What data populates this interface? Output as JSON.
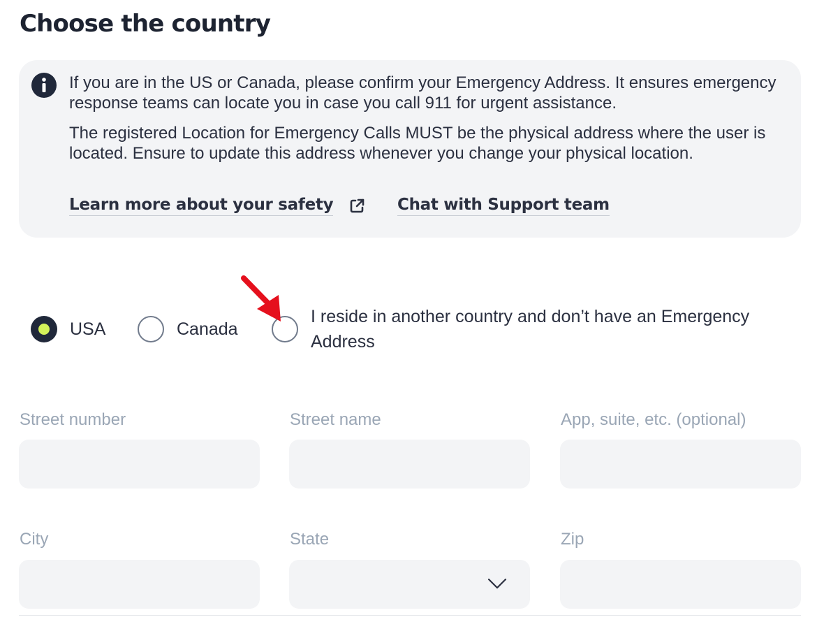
{
  "page": {
    "title": "Choose the country"
  },
  "info": {
    "icon": "info-circle-icon",
    "paragraph_1": "If you are in the US or Canada, please confirm your Emergency Address. It ensures emergency response teams can locate you in case you call 911 for urgent assistance.",
    "paragraph_2": "The registered Location for Emergency Calls MUST be the physical address where the user is located. Ensure to update this address whenever you change your physical location.",
    "link_safety": "Learn more about your safety",
    "link_safety_icon": "external-link-icon",
    "link_support": "Chat with Support team"
  },
  "country": {
    "selected": "USA",
    "options": [
      {
        "label": "USA",
        "checked": true
      },
      {
        "label": "Canada",
        "checked": false
      },
      {
        "label": "I reside in another country and don’t have an Emergency Address",
        "checked": false
      }
    ]
  },
  "annotation": {
    "icon": "red-arrow-icon",
    "color": "#e5101d"
  },
  "form": {
    "street_number": {
      "label": "Street number",
      "value": ""
    },
    "street_name": {
      "label": "Street name",
      "value": ""
    },
    "apartment": {
      "label": "App, suite, etc. (optional)",
      "value": ""
    },
    "city": {
      "label": "City",
      "value": ""
    },
    "state": {
      "label": "State",
      "value": "",
      "icon": "chevron-down-icon"
    },
    "zip": {
      "label": "Zip",
      "value": ""
    }
  },
  "colors": {
    "accent_dark": "#20283a",
    "accent_lime": "#d4f25a",
    "panel_bg": "#f3f4f6",
    "label_muted": "#9aa6b5"
  }
}
